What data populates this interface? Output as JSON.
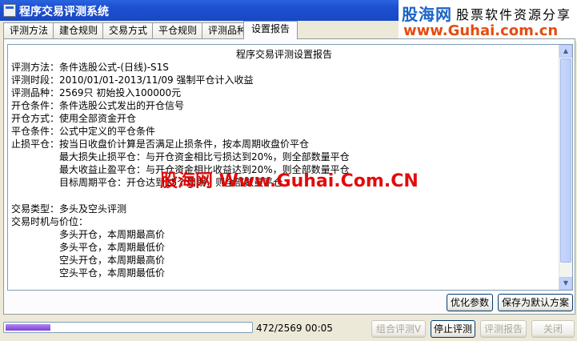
{
  "window": {
    "title": "程序交易评测系统"
  },
  "logo": {
    "brand": "股海网",
    "slogan": "股票软件资源分享",
    "url": "www.Guhai.com.cn"
  },
  "tabs": [
    "评测方法",
    "建仓规则",
    "交易方式",
    "平仓规则",
    "评测品种",
    "设置报告"
  ],
  "active_tab": "设置报告",
  "report": {
    "title": "程序交易评测设置报告",
    "lines": [
      "评测方法：条件选股公式-(日线)-S1S",
      "评测时段：2010/01/01-2013/11/09 强制平仓计入收益",
      "评测品种：2569只 初始投入100000元",
      "开仓条件：条件选股公式发出的开仓信号",
      "开仓方式：使用全部资金开仓",
      "平仓条件：公式中定义的平仓条件",
      "止损平仓：按当日收盘价计算是否满足止损条件，按本周期收盘价平仓",
      "最大损失止损平仓：与开仓资金相比亏损达到20%，则全部数量平仓",
      "最大收益止盈平仓：与开仓资金相比收益达到20%，则全部数量平仓",
      "目标周期平仓：开仓达到15个周期，则全部数量平仓",
      "交易类型：多头及空头评测",
      "交易时机与价位：",
      "多头开仓，本周期最高价",
      "多头平仓，本周期最低价",
      "空头开仓，本周期最高价",
      "空头平仓，本周期最低价"
    ]
  },
  "watermark": "股海网 Www.Guhai.Com.CN",
  "buttons": {
    "optimize": "优化参数",
    "save_default": "保存为默认方案",
    "combo_eval": "组合评测V",
    "stop_eval": "停止评测",
    "eval_report": "评测报告",
    "close": "关闭"
  },
  "progress": {
    "current": 472,
    "total": 2569,
    "text": "472/2569 00:05"
  }
}
